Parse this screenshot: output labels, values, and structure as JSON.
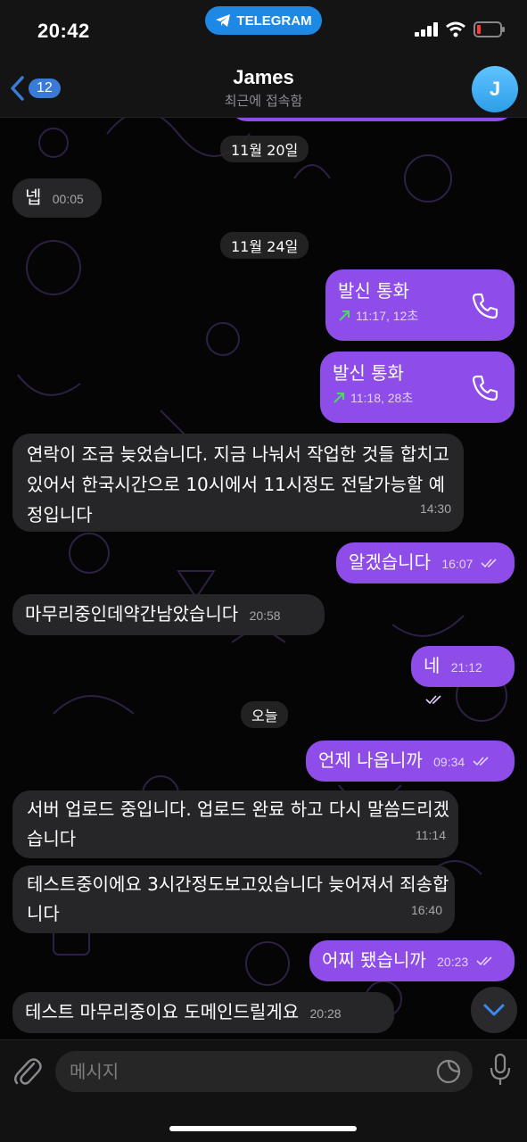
{
  "status_bar": {
    "time": "20:42",
    "app_pill": "TELEGRAM"
  },
  "header": {
    "back_count": "12",
    "name": "James",
    "status": "최근에 접속함",
    "avatar_letter": "J"
  },
  "dates": {
    "nov20": "11월 20일",
    "nov24": "11월 24일",
    "today": "오늘"
  },
  "messages": [
    {
      "dir": "in",
      "text": "넵",
      "time": "00:05"
    },
    {
      "dir": "out",
      "type": "call",
      "text": "발신 통화",
      "time": "11:17, 12초"
    },
    {
      "dir": "out",
      "type": "call",
      "text": "발신 통화",
      "time": "11:18, 28초"
    },
    {
      "dir": "in",
      "text": "연락이 조금 늦었습니다. 지금 나눠서 작업한 것들 합치고 있어서 한국시간으로 10시에서 11시정도 전달가능할 예정입니다",
      "time": "14:30"
    },
    {
      "dir": "out",
      "text": "알겠습니다",
      "time": "16:07"
    },
    {
      "dir": "in",
      "text": "마무리중인데약간남았습니다",
      "time": "20:58"
    },
    {
      "dir": "out",
      "text": "네",
      "time": "21:12"
    },
    {
      "dir": "out",
      "text": "언제 나옵니까",
      "time": "09:34"
    },
    {
      "dir": "in",
      "text": "서버 업로드 중입니다. 업로드 완료 하고 다시 말씀드리겠습니다",
      "time": "11:14"
    },
    {
      "dir": "in",
      "text": "테스트중이에요 3시간정도보고있습니다 늦어져서 죄송합니다",
      "time": "16:40"
    },
    {
      "dir": "out",
      "text": "어찌 됐습니까",
      "time": "20:23"
    },
    {
      "dir": "in",
      "text": "테스트 마무리중이요 도메인드릴게요",
      "time": "20:28"
    }
  ],
  "input": {
    "placeholder": "메시지"
  },
  "colors": {
    "outgoing_bubble": "#8e4de8",
    "incoming_bubble": "#262628",
    "accent": "#3a7bd5",
    "call_arrow": "#4cd964"
  },
  "icons": [
    "back-chevron-icon",
    "telegram-plane-icon",
    "signal-icon",
    "wifi-icon",
    "battery-icon",
    "phone-icon",
    "read-checks-icon",
    "attach-paperclip-icon",
    "sticker-icon",
    "microphone-icon",
    "chevron-down-icon"
  ]
}
